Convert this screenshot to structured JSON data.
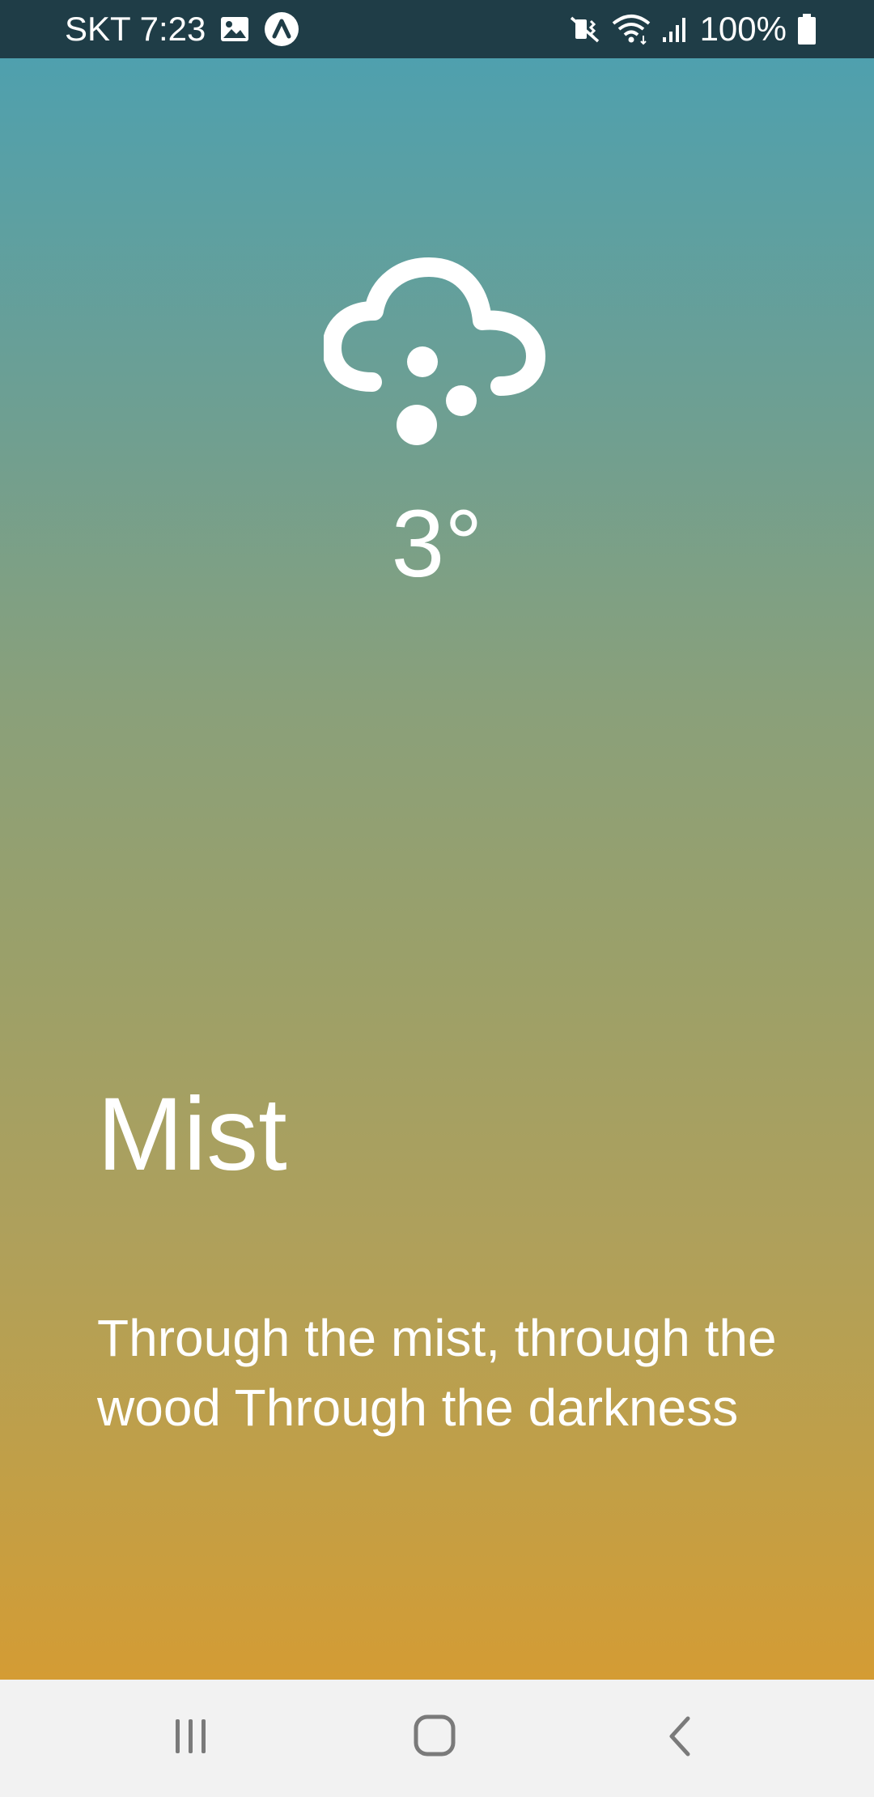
{
  "status_bar": {
    "carrier_time": "SKT 7:23",
    "battery_percent": "100%",
    "icons": [
      "gallery-icon",
      "app-notification-icon",
      "mute-vibrate-icon",
      "wifi-icon",
      "signal-icon",
      "battery-icon"
    ]
  },
  "weather": {
    "icon": "cloud-hail-icon",
    "temperature": "3°",
    "condition": "Mist",
    "description": "Through the mist, through the wood Through the darkness"
  },
  "colors": {
    "status_bar_bg": "#1f3d47",
    "gradient_top": "#4fa0ae",
    "gradient_bottom": "#d49c34",
    "nav_bar_bg": "#f2f2f2",
    "nav_icon": "#7a7a7a",
    "text": "#ffffff"
  },
  "nav_bar": {
    "buttons": [
      "recent-apps",
      "home",
      "back"
    ]
  }
}
